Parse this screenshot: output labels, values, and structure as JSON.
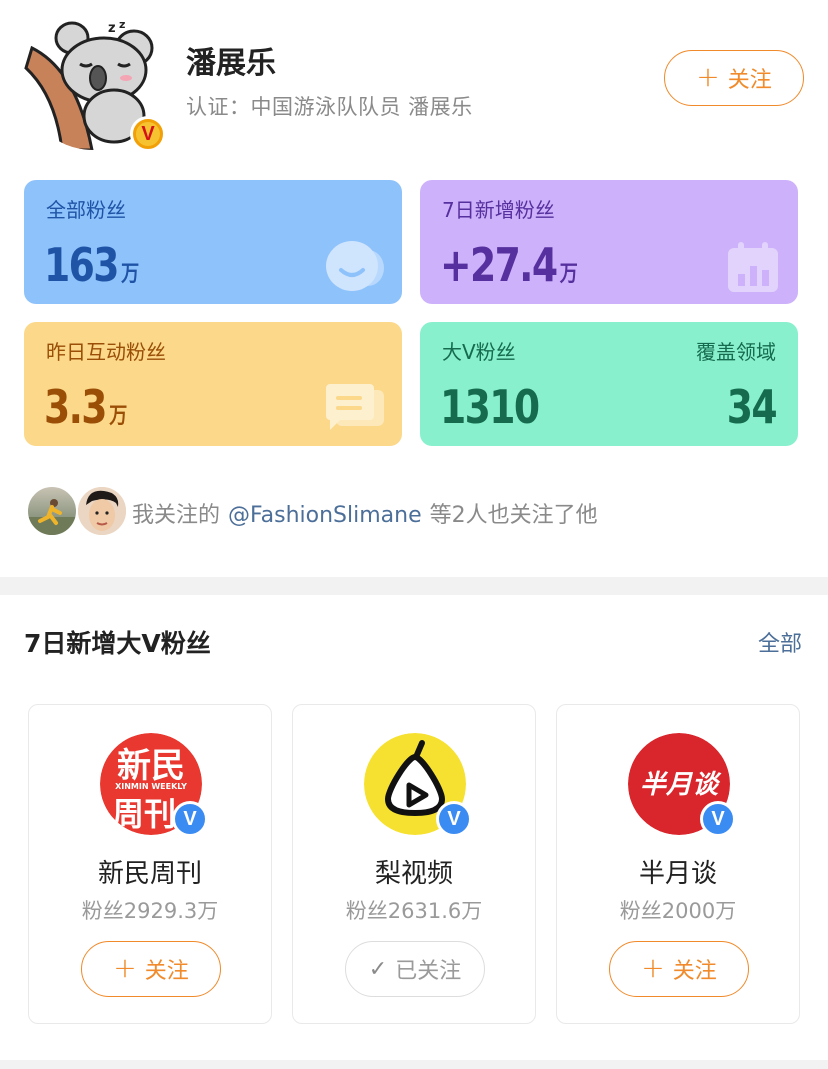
{
  "profile": {
    "name": "潘展乐",
    "cert": "认证：中国游泳队队员 潘展乐",
    "verified_mark": "V",
    "follow_label": "关注",
    "plus_glyph": "+"
  },
  "stats": {
    "all_fans": {
      "label": "全部粉丝",
      "value": "163",
      "unit": "万"
    },
    "new_fans_7d": {
      "label": "7日新增粉丝",
      "value": "+27.4",
      "unit": "万"
    },
    "interact_yesterday": {
      "label": "昨日互动粉丝",
      "value": "3.3",
      "unit": "万"
    },
    "big_v": {
      "label": "大V粉丝",
      "value": "1310",
      "right_label": "覆盖领域",
      "right_value": "34"
    }
  },
  "mutual": {
    "prefix": "我关注的",
    "link": "@FashionSlimane",
    "suffix": "等2人也关注了他"
  },
  "section": {
    "title": "7日新增大V粉丝",
    "all_label": "全部"
  },
  "v_accounts": [
    {
      "name": "新民周刊",
      "fans": "粉丝2929.3万",
      "button": "关注",
      "followed": false,
      "logo_top": "新民",
      "logo_sub": "XINMIN WEEKLY",
      "logo_bottom": "周刊",
      "verified_mark": "V"
    },
    {
      "name": "梨视频",
      "fans": "粉丝2631.6万",
      "button": "已关注",
      "followed": true,
      "verified_mark": "V"
    },
    {
      "name": "半月谈",
      "fans": "粉丝2000万",
      "button": "关注",
      "followed": false,
      "logo_text": "半月谈",
      "verified_mark": "V"
    }
  ],
  "colors": {
    "accent_orange": "#f08a2b",
    "link_blue": "#4c6f99",
    "card_fans": "#8ec2fb",
    "card_new": "#cdb1fa",
    "card_interact": "#fbd88a",
    "card_bigv": "#88f0cd",
    "verified_blue": "#3b8cf2",
    "verified_gold": "#f2a007"
  }
}
